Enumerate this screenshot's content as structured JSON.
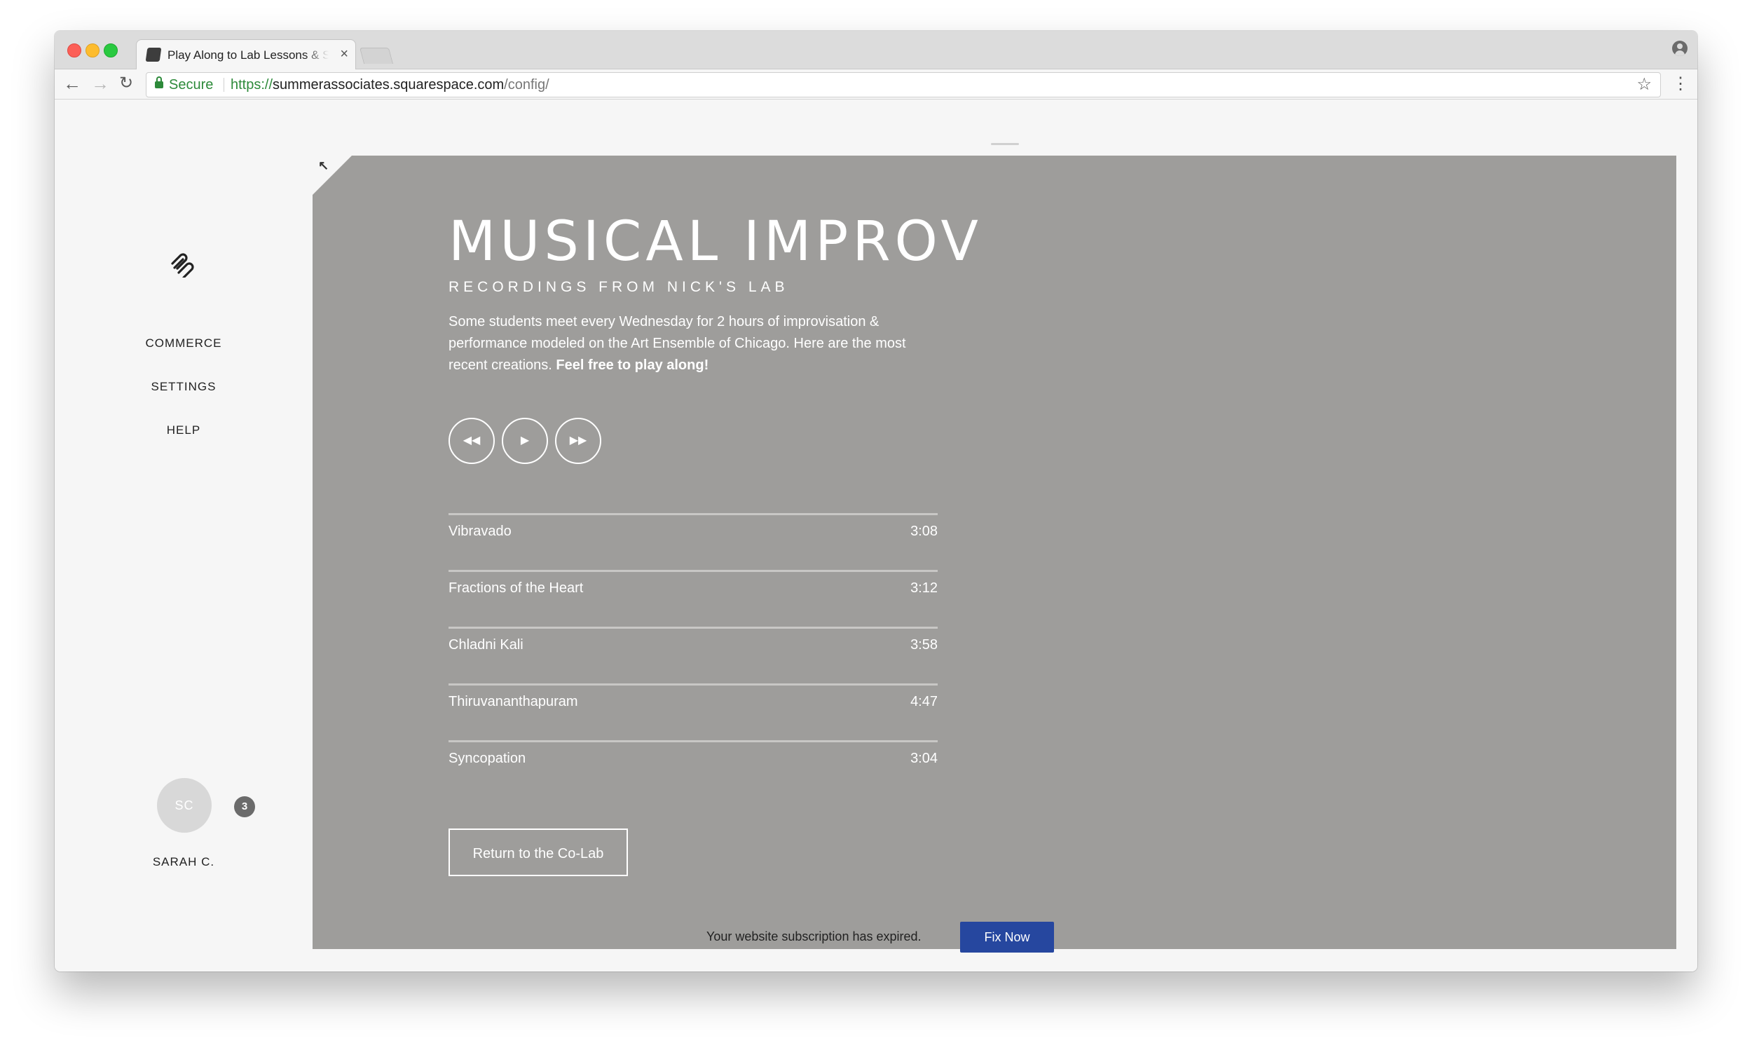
{
  "browser": {
    "tab_title": "Play Along to Lab Lessons & Summer Associates",
    "secure_label": "Secure",
    "url_scheme": "https://",
    "url_host": "summerassociates.squarespace.com",
    "url_path": "/config/"
  },
  "sidebar": {
    "items": [
      {
        "label": "COMMERCE"
      },
      {
        "label": "SETTINGS"
      },
      {
        "label": "HELP"
      }
    ],
    "user": {
      "initials": "SC",
      "name": "SARAH C.",
      "notifications": "3"
    }
  },
  "page": {
    "title": "MUSICAL IMPROV",
    "subtitle": "RECORDINGS FROM NICK'S LAB",
    "intro": "Some students meet every Wednesday for 2 hours of improvisation & performance modeled on the Art Ensemble of Chicago. Here are the most recent creations.",
    "intro_emphasis": "Feel free to play along!",
    "tracks": [
      {
        "title": "Vibravado",
        "duration": "3:08"
      },
      {
        "title": "Fractions of the Heart",
        "duration": "3:12"
      },
      {
        "title": "Chladni Kali",
        "duration": "3:58"
      },
      {
        "title": "Thiruvananthapuram",
        "duration": "4:47"
      },
      {
        "title": "Syncopation",
        "duration": "3:04"
      }
    ],
    "cta_label": "Return to the Co-Lab"
  },
  "banner": {
    "message": "Your website subscription has expired.",
    "button_label": "Fix Now"
  },
  "colors": {
    "preview_background": "#9e9d9b",
    "fix_button": "#26479f"
  }
}
